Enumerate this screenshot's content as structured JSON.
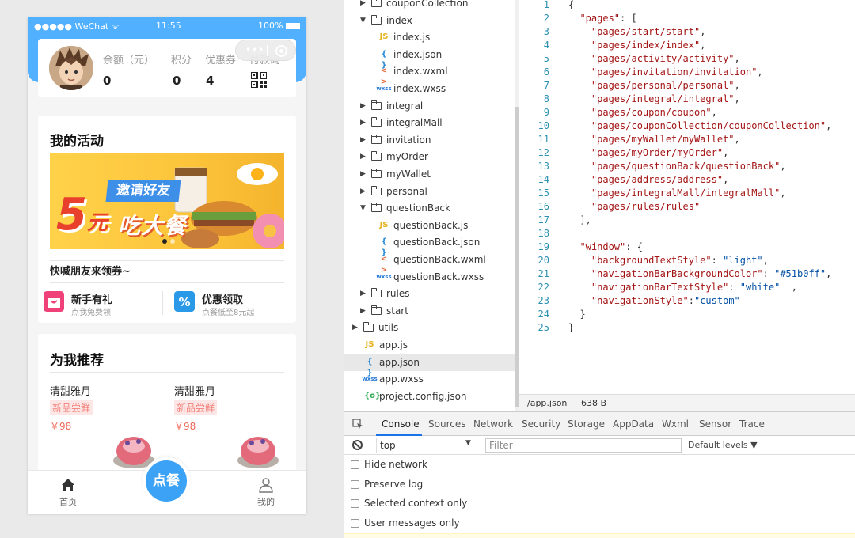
{
  "phone": {
    "status_bar": {
      "carrier": "●●●●● WeChat ᯤ",
      "time": "11:55",
      "battery": "100%"
    },
    "user": {
      "stats": [
        {
          "label": "余额（元）",
          "value": "0"
        },
        {
          "label": "积分",
          "value": "0"
        },
        {
          "label": "优惠券",
          "value": "4"
        },
        {
          "label": "付款码",
          "value": ""
        }
      ]
    },
    "capsule": {
      "more": "•••"
    },
    "activity": {
      "title": "我的活动",
      "banner": {
        "ribbon": "邀请好友",
        "amount": "5",
        "unit": "元",
        "slogan": "吃大餐"
      },
      "invite_text": "快喊朋友来领券~",
      "quick_items": [
        {
          "title": "新手有礼",
          "subtitle": "点我免费领"
        },
        {
          "title": "优惠领取",
          "subtitle": "点餐低至8元起"
        }
      ]
    },
    "recommend": {
      "title": "为我推荐",
      "products": [
        {
          "name": "清甜雅月",
          "tag": "新品尝鲜",
          "price": "￥98"
        },
        {
          "name": "清甜雅月",
          "tag": "新品尝鲜",
          "price": "￥98"
        }
      ]
    },
    "tab_bar": {
      "home": "首页",
      "order": "点餐",
      "mine": "我的"
    }
  },
  "file_tree": {
    "items": [
      {
        "type": "folder",
        "name": "couponCollection",
        "open": false,
        "depth": 1
      },
      {
        "type": "folder",
        "name": "index",
        "open": true,
        "depth": 1
      },
      {
        "type": "js",
        "name": "index.js",
        "depth": 2
      },
      {
        "type": "json",
        "name": "index.json",
        "depth": 2
      },
      {
        "type": "wxml",
        "name": "index.wxml",
        "depth": 2
      },
      {
        "type": "wxss",
        "name": "index.wxss",
        "depth": 2
      },
      {
        "type": "folder",
        "name": "integral",
        "open": false,
        "depth": 1
      },
      {
        "type": "folder",
        "name": "integralMall",
        "open": false,
        "depth": 1
      },
      {
        "type": "folder",
        "name": "invitation",
        "open": false,
        "depth": 1
      },
      {
        "type": "folder",
        "name": "myOrder",
        "open": false,
        "depth": 1
      },
      {
        "type": "folder",
        "name": "myWallet",
        "open": false,
        "depth": 1
      },
      {
        "type": "folder",
        "name": "personal",
        "open": false,
        "depth": 1
      },
      {
        "type": "folder",
        "name": "questionBack",
        "open": true,
        "depth": 1
      },
      {
        "type": "js",
        "name": "questionBack.js",
        "depth": 2
      },
      {
        "type": "json",
        "name": "questionBack.json",
        "depth": 2
      },
      {
        "type": "wxml",
        "name": "questionBack.wxml",
        "depth": 2
      },
      {
        "type": "wxss",
        "name": "questionBack.wxss",
        "depth": 2
      },
      {
        "type": "folder",
        "name": "rules",
        "open": false,
        "depth": 1
      },
      {
        "type": "folder",
        "name": "start",
        "open": false,
        "depth": 1
      },
      {
        "type": "folder",
        "name": "utils",
        "open": false,
        "depth": 0
      },
      {
        "type": "js",
        "name": "app.js",
        "depth": 0
      },
      {
        "type": "json",
        "name": "app.json",
        "depth": 0,
        "selected": true
      },
      {
        "type": "wxss",
        "name": "app.wxss",
        "depth": 0
      },
      {
        "type": "config",
        "name": "project.config.json",
        "depth": 0
      }
    ],
    "icon_labels": {
      "js": "JS",
      "json": "{ }",
      "wxml": "< >",
      "wxss": "wxss",
      "config": "{o}"
    }
  },
  "editor": {
    "lines": [
      "{",
      "  \"pages\": [",
      "    \"pages/start/start\",",
      "    \"pages/index/index\",",
      "    \"pages/activity/activity\",",
      "    \"pages/invitation/invitation\",",
      "    \"pages/personal/personal\",",
      "    \"pages/integral/integral\",",
      "    \"pages/coupon/coupon\",",
      "    \"pages/couponCollection/couponCollection\",",
      "    \"pages/myWallet/myWallet\",",
      "    \"pages/myOrder/myOrder\",",
      "    \"pages/questionBack/questionBack\",",
      "    \"pages/address/address\",",
      "    \"pages/integralMall/integralMall\",",
      "    \"pages/rules/rules\"",
      "  ],",
      "",
      "  \"window\": {",
      "    \"backgroundTextStyle\": \"light\",",
      "    \"navigationBarBackgroundColor\": \"#51b0ff\",",
      "    \"navigationBarTextStyle\": \"white\"  ,",
      "    \"navigationStyle\":\"custom\"",
      "  }",
      "}"
    ],
    "status": {
      "path": "/app.json",
      "size": "638 B"
    }
  },
  "devtools": {
    "tabs": [
      "Console",
      "Sources",
      "Network",
      "Security",
      "Storage",
      "AppData",
      "Wxml",
      "Sensor",
      "Trace"
    ],
    "active_tab": "Console",
    "context": "top",
    "filter_placeholder": "Filter",
    "levels": "Default levels ▼",
    "options": [
      "Hide network",
      "Preserve log",
      "Selected context only",
      "User messages only"
    ]
  },
  "colors": {
    "brand_blue": "#51b0ff",
    "order_blue": "#3ba2f5",
    "tag_red": "#f3807a"
  }
}
